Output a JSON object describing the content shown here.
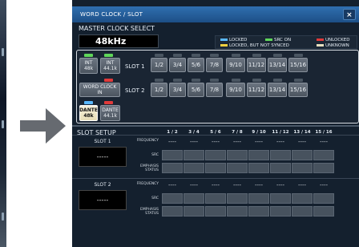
{
  "window": {
    "title": "WORD CLOCK / SLOT",
    "close_label": "×"
  },
  "master_clock": {
    "label": "MASTER CLOCK SELECT",
    "value": "48kHz"
  },
  "legend": [
    {
      "color": "#5ab8ff",
      "label": "LOCKED"
    },
    {
      "color": "#f0d040",
      "label": "LOCKED, BUT NOT SYNCED"
    },
    {
      "color": "#5fd65a",
      "label": "SRC ON"
    },
    {
      "color": "#e03a3a",
      "label": "UNLOCKED"
    },
    {
      "color": "#e8e0c0",
      "label": "UNKNOWN"
    }
  ],
  "clock_sources": {
    "int48": {
      "line1": "INT",
      "line2": "48k"
    },
    "int441": {
      "line1": "INT",
      "line2": "44.1k"
    },
    "wordclock": {
      "label": "WORD CLOCK IN"
    },
    "dante48": {
      "line1": "DANTE",
      "line2": "48k"
    },
    "dante441": {
      "line1": "DANTE",
      "line2": "44.1k"
    }
  },
  "slot_rows": [
    {
      "label": "SLOT 1"
    },
    {
      "label": "SLOT 2"
    }
  ],
  "slot_channels": [
    "1/2",
    "3/4",
    "5/6",
    "7/8",
    "9/10",
    "11/12",
    "13/14",
    "15/16"
  ],
  "slot_setup": {
    "title": "SLOT SETUP",
    "columns": [
      "1 / 2",
      "3 / 4",
      "5 / 6",
      "7 / 8",
      "9 / 10",
      "11 / 12",
      "13 / 14",
      "15 / 16"
    ],
    "row_labels": {
      "frequency": "FREQUENCY",
      "src": "SRC",
      "emphasis": "EMPHASIS STATUS"
    },
    "dash": "----",
    "slots": [
      {
        "name": "SLOT 1",
        "display": "-----"
      },
      {
        "name": "SLOT 2",
        "display": "-----"
      }
    ]
  }
}
